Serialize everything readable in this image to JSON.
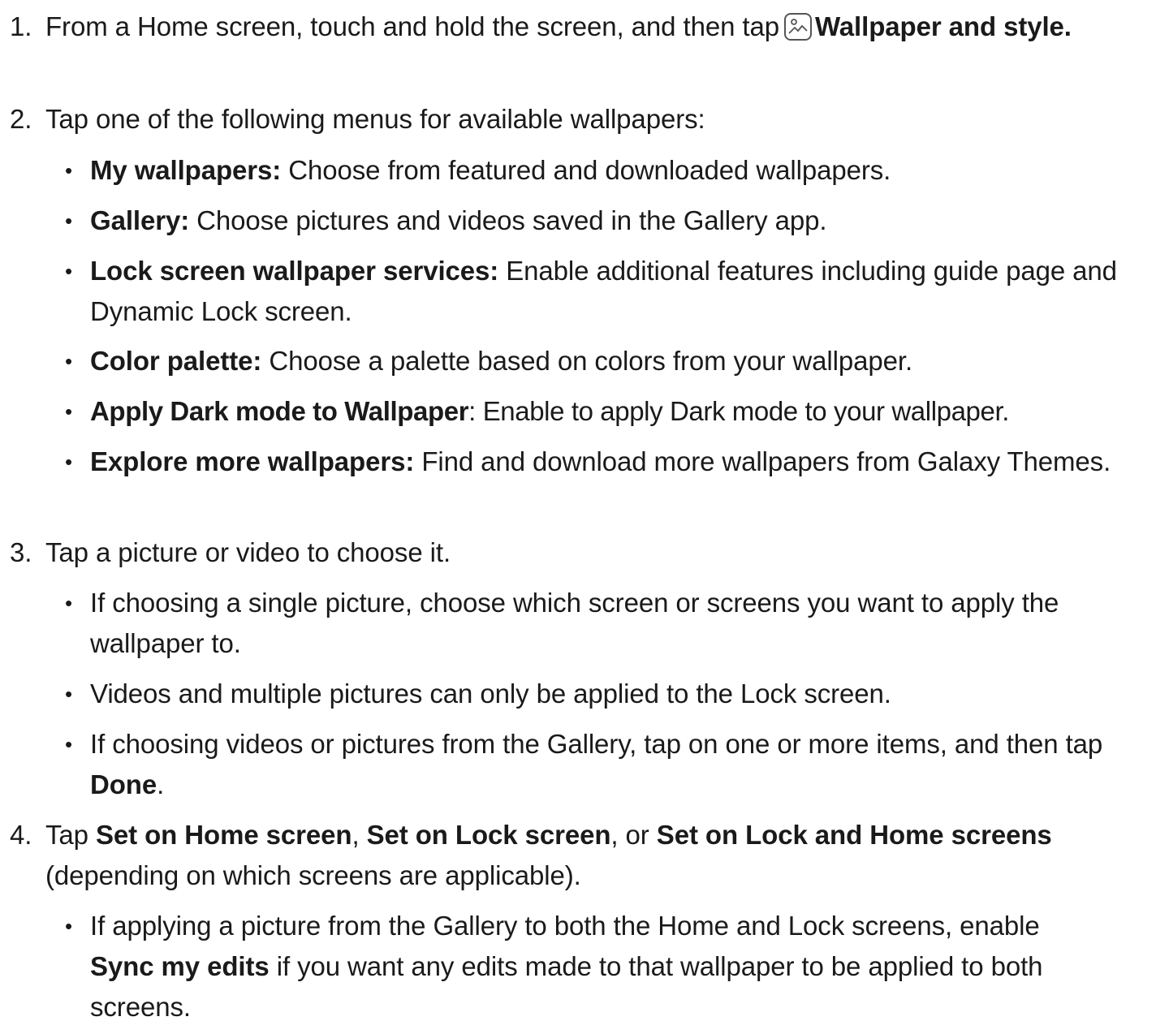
{
  "steps": [
    {
      "num": "1.",
      "before": "From a Home screen, touch and hold the screen, and then tap",
      "icon": "wallpaper-icon",
      "bold": "Wallpaper and style."
    },
    {
      "num": "2.",
      "text": "Tap one of the following menus for available wallpapers:",
      "items": [
        {
          "bold": "My wallpapers:",
          "rest": " Choose from featured and downloaded wallpapers."
        },
        {
          "bold": "Gallery:",
          "rest": " Choose pictures and videos saved in the Gallery app."
        },
        {
          "bold": "Lock screen wallpaper services:",
          "rest": " Enable additional features including guide page and Dynamic Lock screen."
        },
        {
          "bold": "Color palette:",
          "rest": " Choose a palette based on colors from your wallpaper."
        },
        {
          "bold": "Apply Dark mode to Wallpaper",
          "rest": ": Enable to apply Dark mode to your wallpaper."
        },
        {
          "bold": "Explore more wallpapers:",
          "rest": " Find and download more wallpapers from Galaxy Themes."
        }
      ]
    },
    {
      "num": "3.",
      "text": "Tap a picture or video to choose it.",
      "items": [
        {
          "text": "If choosing a single picture, choose which screen or screens you want to apply the wallpaper to."
        },
        {
          "text": "Videos and multiple pictures can only be applied to the Lock screen."
        },
        {
          "before": "If choosing videos or pictures from the Gallery, tap on one or more items, and then tap ",
          "bold": "Done",
          "after": "."
        }
      ]
    },
    {
      "num": "4.",
      "t1": "Tap ",
      "b1": "Set on Home screen",
      "t2": ", ",
      "b2": "Set on Lock screen",
      "t3": ", or ",
      "b3": "Set on Lock and Home screens",
      "t4": " (depending on which screens are applicable).",
      "items": [
        {
          "before": "If applying a picture from the Gallery to both the Home and Lock screens, enable ",
          "bold": "Sync my edits",
          "after": " if you want any edits made to that wallpaper to be applied to both screens."
        }
      ]
    }
  ],
  "bullet_char": "•"
}
